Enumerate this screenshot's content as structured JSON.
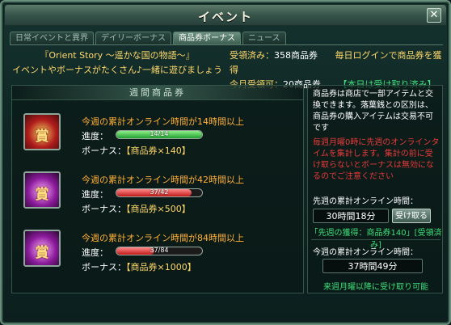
{
  "window": {
    "title": "イベント",
    "close_label": "✕"
  },
  "tabs": [
    {
      "label": "日常イベントと異界",
      "active": false
    },
    {
      "label": "デイリーボーナス",
      "active": false
    },
    {
      "label": "商品券ボーナス",
      "active": true
    },
    {
      "label": "ニュース",
      "active": false
    }
  ],
  "banner": {
    "line1": "『Orient Story ～遥かな国の物語～』",
    "line2": "イベントやボーナスがたくさん♪一緒に遊びましょう",
    "received_label": "受領済み：",
    "received_value": "358商品券",
    "login_notice": "毎日ログインで商品券を獲得",
    "month_label": "今月受領可：",
    "month_value": "20商品券",
    "today_status": "【本日は受け取り済み】"
  },
  "weekly": {
    "header": "週間商品券",
    "progress_label": "進度：",
    "bonus_label": "ボーナス：",
    "rows": [
      {
        "title": "今週の累計オンライン時間が14時間以上",
        "progress_text": "14/14",
        "progress": 1.0,
        "bonus": "【商品券×140】",
        "icon": "gift-bag-red-icon",
        "kanji": "賞"
      },
      {
        "title": "今週の累計オンライン時間が42時間以上",
        "progress_text": "37/42",
        "progress": 0.881,
        "bonus": "【商品券×500】",
        "icon": "gift-bag-purple-icon",
        "kanji": "賞"
      },
      {
        "title": "今週の累計オンライン時間が84時間以上",
        "progress_text": "37/84",
        "progress": 0.44,
        "bonus": "【商品券×1000】",
        "icon": "gift-bags-purple-icon",
        "kanji": "賞"
      }
    ]
  },
  "side": {
    "info": "商品券は商店で一部アイテムと交換できます。落葉銭との区別は、商品券の購入アイテムは交易不可です",
    "warning": "毎週月曜0時に先週のオンラインタイムを集計します。集計の前に受け取らないとボーナスは無効になるのでご注意ください",
    "last_week_label": "先週の累計オンライン時間：",
    "last_week_time": "30時間18分",
    "receive_button": "受け取る",
    "last_week_reward": "「先週の獲得：商品券140」[受領済み]",
    "this_week_label": "今週の累計オンライン時間：",
    "this_week_time": "37時間49分",
    "next_claim": "来週月曜以降に受け取り可能"
  },
  "colors": {
    "accent_gold": "#ffd86a",
    "accent_green": "#3fe07a",
    "warning_red": "#e83a3a",
    "title_orange": "#ffb03a"
  }
}
